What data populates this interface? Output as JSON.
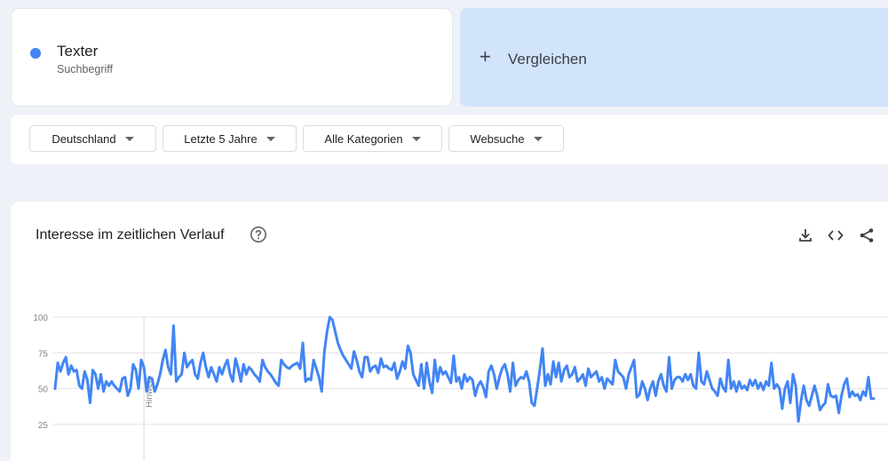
{
  "term": {
    "name": "Texter",
    "subtitle": "Suchbegriff",
    "color": "#4285f4"
  },
  "compare": {
    "plus": "+",
    "label": "Vergleichen"
  },
  "filters": [
    {
      "label": "Deutschland"
    },
    {
      "label": "Letzte 5 Jahre"
    },
    {
      "label": "Alle Kategorien"
    },
    {
      "label": "Websuche"
    }
  ],
  "chart_card": {
    "title": "Interesse im zeitlichen Verlauf",
    "help_icon": "help-icon",
    "actions": [
      "download-icon",
      "embed-code-icon",
      "share-icon"
    ]
  },
  "chart_data": {
    "type": "line",
    "title": "",
    "xlabel": "",
    "ylabel": "",
    "ylim": [
      0,
      100
    ],
    "yticks": [
      25,
      50,
      75,
      100
    ],
    "grid": true,
    "annotation": "Hinweis",
    "series_color": "#4285f4",
    "series": [
      {
        "values": [
          50,
          68,
          62,
          68,
          72,
          60,
          66,
          62,
          63,
          52,
          50,
          62,
          56,
          40,
          63,
          60,
          50,
          60,
          48,
          55,
          52,
          55,
          52,
          50,
          48,
          57,
          58,
          45,
          50,
          67,
          63,
          50,
          70,
          65,
          48,
          58,
          57,
          48,
          53,
          60,
          70,
          77,
          65,
          60,
          94,
          55,
          58,
          60,
          75,
          65,
          68,
          70,
          60,
          57,
          68,
          75,
          65,
          58,
          65,
          60,
          55,
          65,
          60,
          66,
          70,
          60,
          55,
          71,
          64,
          55,
          67,
          60,
          65,
          63,
          60,
          58,
          55,
          70,
          65,
          62,
          60,
          57,
          54,
          52,
          70,
          67,
          65,
          64,
          66,
          67,
          68,
          64,
          82,
          55,
          57,
          56,
          70,
          64,
          58,
          48,
          76,
          90,
          100,
          98,
          90,
          82,
          77,
          73,
          70,
          67,
          64,
          76,
          70,
          62,
          58,
          72,
          72,
          62,
          65,
          66,
          61,
          71,
          65,
          66,
          64,
          63,
          68,
          57,
          62,
          69,
          64,
          80,
          75,
          60,
          56,
          52,
          67,
          50,
          68,
          55,
          47,
          70,
          55,
          65,
          60,
          62,
          58,
          54,
          73,
          55,
          58,
          50,
          60,
          55,
          58,
          56,
          45,
          52,
          55,
          51,
          44,
          62,
          66,
          60,
          50,
          58,
          64,
          67,
          60,
          48,
          68,
          52,
          56,
          58,
          57,
          62,
          55,
          40,
          38,
          50,
          63,
          78,
          52,
          60,
          53,
          69,
          58,
          68,
          55,
          63,
          66,
          58,
          60,
          65,
          55,
          57,
          60,
          52,
          64,
          58,
          60,
          62,
          55,
          58,
          50,
          57,
          55,
          53,
          70,
          62,
          60,
          58,
          50,
          60,
          65,
          70,
          44,
          46,
          55,
          50,
          42,
          50,
          55,
          45,
          55,
          60,
          52,
          48,
          72,
          50,
          56,
          58,
          58,
          55,
          60,
          56,
          60,
          52,
          50,
          75,
          55,
          53,
          62,
          56,
          50,
          48,
          45,
          57,
          51,
          48,
          70,
          50,
          55,
          48,
          55,
          50,
          52,
          49,
          56,
          52,
          56,
          50,
          54,
          49,
          55,
          52,
          68,
          50,
          53,
          50,
          36,
          50,
          55,
          40,
          60,
          52,
          27,
          42,
          52,
          42,
          38,
          45,
          52,
          45,
          35,
          38,
          40,
          53,
          45,
          44,
          45,
          33,
          45,
          53,
          57,
          44,
          48,
          45,
          46,
          42,
          48,
          45,
          58,
          43,
          43
        ]
      }
    ]
  }
}
